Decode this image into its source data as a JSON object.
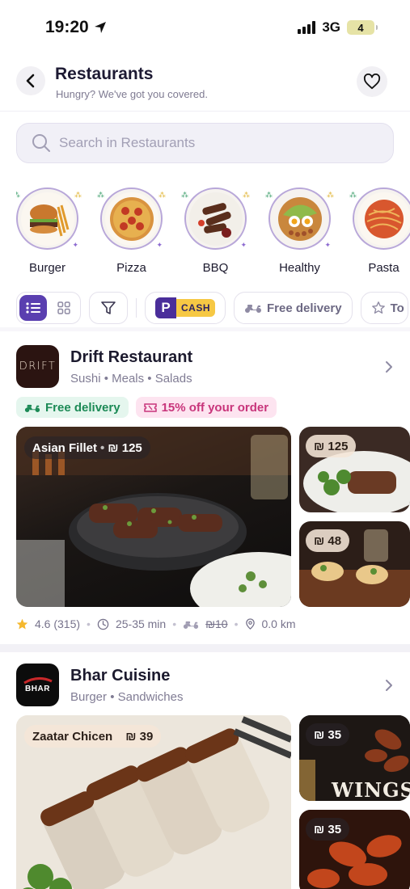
{
  "status": {
    "time": "19:20",
    "network": "3G",
    "battery": "4"
  },
  "header": {
    "title": "Restaurants",
    "subtitle": "Hungry? We've got you covered."
  },
  "search": {
    "placeholder": "Search in Restaurants"
  },
  "categories": [
    {
      "label": "Burger"
    },
    {
      "label": "Pizza"
    },
    {
      "label": "BBQ"
    },
    {
      "label": "Healthy"
    },
    {
      "label": "Pasta"
    }
  ],
  "filters": {
    "pcash_p": "P",
    "pcash_label": "CASH",
    "free_delivery": "Free delivery",
    "top": "To"
  },
  "restaurants": [
    {
      "name": "Drift Restaurant",
      "tags": "Sushi • Meals • Salads",
      "logo_text": "DRIFT",
      "badges": {
        "delivery": "Free delivery",
        "discount": "15% off your order"
      },
      "dishes": [
        {
          "name": "Asian Fillet",
          "price": "₪ 125"
        },
        {
          "price": "₪ 125"
        },
        {
          "price": "₪ 48"
        }
      ],
      "meta": {
        "rating": "4.6 (315)",
        "time": "25-35 min",
        "fee": "₪10",
        "distance": "0.0 km"
      }
    },
    {
      "name": "Bhar Cuisine",
      "tags": "Burger • Sandwiches",
      "logo_text": "BHAR",
      "dishes": [
        {
          "name": "Zaatar Chicen",
          "price": "₪ 39"
        },
        {
          "price": "₪ 35",
          "overlay": "WINGS"
        },
        {
          "price": "₪ 35"
        }
      ]
    }
  ],
  "colors": {
    "accent": "#5a3fb0",
    "green": "#1c8a56",
    "pink": "#c8357b",
    "star": "#f5b82e"
  }
}
